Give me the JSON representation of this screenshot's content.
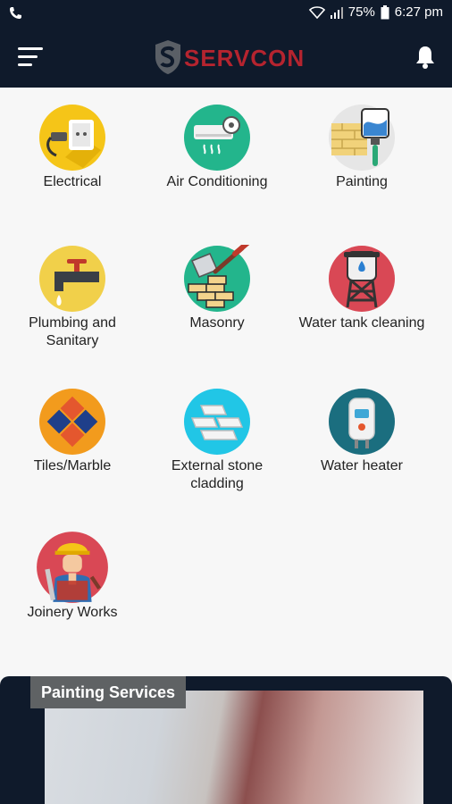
{
  "status": {
    "battery": "75%",
    "time": "6:27 pm"
  },
  "app": {
    "brand": "SERVCON"
  },
  "services": [
    {
      "label": "Electrical",
      "icon": "electrical-socket-icon"
    },
    {
      "label": "Air Conditioning",
      "icon": "air-conditioner-icon"
    },
    {
      "label": "Painting",
      "icon": "paint-roller-icon"
    },
    {
      "label": "Plumbing and\nSanitary",
      "icon": "faucet-icon"
    },
    {
      "label": "Masonry",
      "icon": "trowel-bricks-icon"
    },
    {
      "label": "Water tank cleaning",
      "icon": "water-tank-icon"
    },
    {
      "label": "Tiles/Marble",
      "icon": "tiles-icon"
    },
    {
      "label": "External stone\ncladding",
      "icon": "stone-slabs-icon"
    },
    {
      "label": "Water heater",
      "icon": "water-heater-icon"
    },
    {
      "label": "Joinery Works",
      "icon": "carpenter-icon"
    }
  ],
  "card": {
    "title": "Painting Services"
  },
  "colors": {
    "bar": "#0f1a2b",
    "brand": "#b5242f"
  }
}
